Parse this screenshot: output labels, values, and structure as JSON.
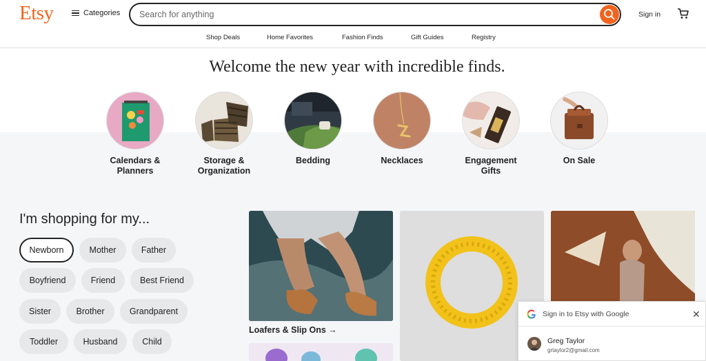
{
  "header": {
    "logo": "Etsy",
    "categories_label": "Categories",
    "search_placeholder": "Search for anything",
    "signin_label": "Sign in"
  },
  "subnav": [
    "Shop Deals",
    "Home Favorites",
    "Fashion Finds",
    "Gift Guides",
    "Registry"
  ],
  "hero": {
    "title": "Welcome the new year with incredible finds."
  },
  "categories": [
    {
      "label": "Calendars &\nPlanners"
    },
    {
      "label": "Storage &\nOrganization"
    },
    {
      "label": "Bedding"
    },
    {
      "label": "Necklaces"
    },
    {
      "label": "Engagement\nGifts"
    },
    {
      "label": "On Sale"
    }
  ],
  "shopping": {
    "title": "I'm shopping for my...",
    "chips": [
      "Newborn",
      "Mother",
      "Father",
      "Boyfriend",
      "Friend",
      "Best Friend",
      "Sister",
      "Brother",
      "Grandparent",
      "Toddler",
      "Husband",
      "Child"
    ],
    "selected": "Newborn"
  },
  "tiles": {
    "first_label": "Loafers & Slip Ons →"
  },
  "google_signin": {
    "title": "Sign in to Etsy with Google",
    "name": "Greg Taylor",
    "email": "grtaylor2@gmail.com"
  },
  "colors": {
    "brand": "#f1641e",
    "background_alt": "#f5f6f8"
  }
}
